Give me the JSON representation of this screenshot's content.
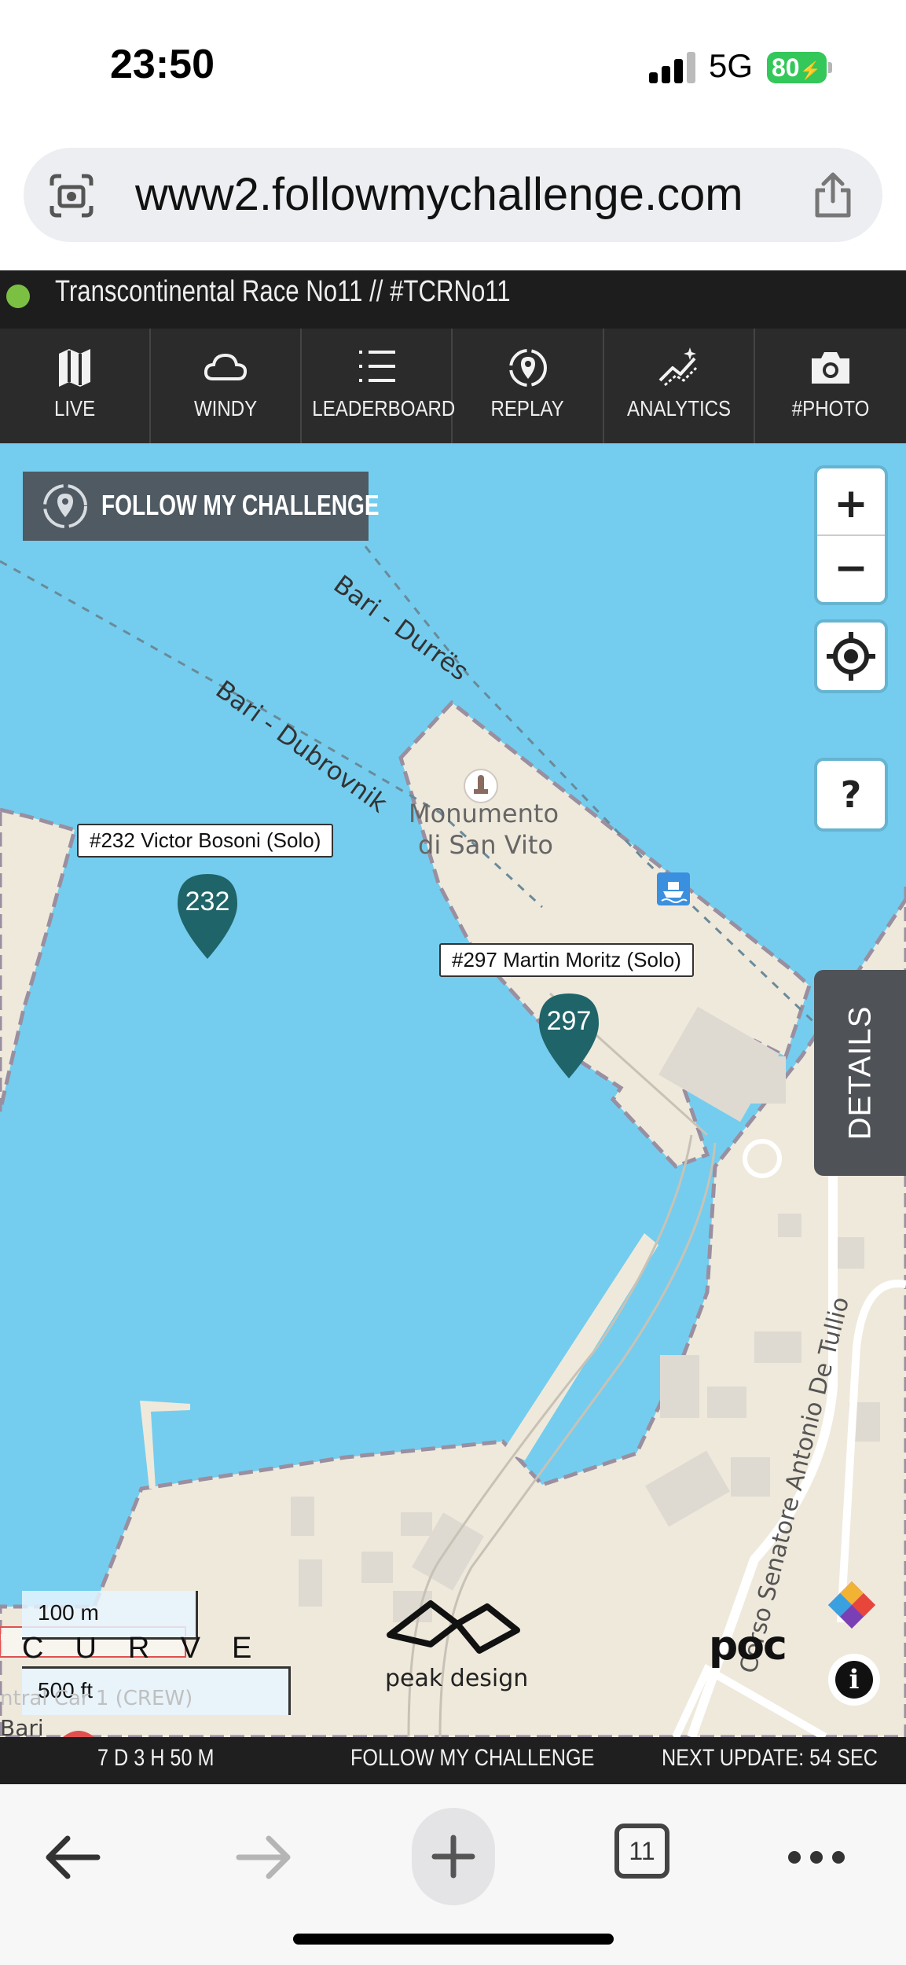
{
  "status_bar": {
    "time": "23:50",
    "network": "5G",
    "battery": "80"
  },
  "browser": {
    "url": "www2.followmychallenge.com",
    "tabs_count": "11"
  },
  "race": {
    "title": "Transcontinental Race No11 // #TCRNo11",
    "live_color": "#7cc043"
  },
  "nav": {
    "items": [
      {
        "label": "LIVE",
        "icon": "map-icon"
      },
      {
        "label": "WINDY",
        "icon": "cloud-icon"
      },
      {
        "label": "LEADERBOARD",
        "icon": "list-icon"
      },
      {
        "label": "REPLAY",
        "icon": "replay-icon"
      },
      {
        "label": "ANALYTICS",
        "icon": "analytics-icon"
      },
      {
        "label": "#PHOTO",
        "icon": "camera-icon"
      }
    ]
  },
  "map": {
    "logo_text": "FOLLOW MY CHALLENGE",
    "zoom_in": "+",
    "zoom_out": "−",
    "help": "?",
    "ferry_routes": [
      "Bari - Durrës",
      "Bari - Dubrovnik"
    ],
    "poi": {
      "line1": "Monumento",
      "line2": "di San Vito"
    },
    "street": "Corso Senatore Antonio De Tullio",
    "riders": [
      {
        "label": "#232 Victor Bosoni (Solo)",
        "number": "232"
      },
      {
        "label": "#297 Martin Moritz (Solo)",
        "number": "297"
      }
    ],
    "details_tab": "DETAILS",
    "scale": {
      "metric": "100 m",
      "imperial": "500 ft"
    },
    "partial_labels": [
      "ntral Car 1 (CREW)",
      "Bari"
    ],
    "sponsors": {
      "curve": "CURVE",
      "peak": "peak design",
      "poc": "poc"
    },
    "water_color": "#74cdee",
    "pin_color": "#1f6468"
  },
  "info_bar": {
    "elapsed": "7 D 3 H 50 M",
    "brand": "FOLLOW MY CHALLENGE",
    "next_update": "NEXT UPDATE: 54 SEC"
  }
}
